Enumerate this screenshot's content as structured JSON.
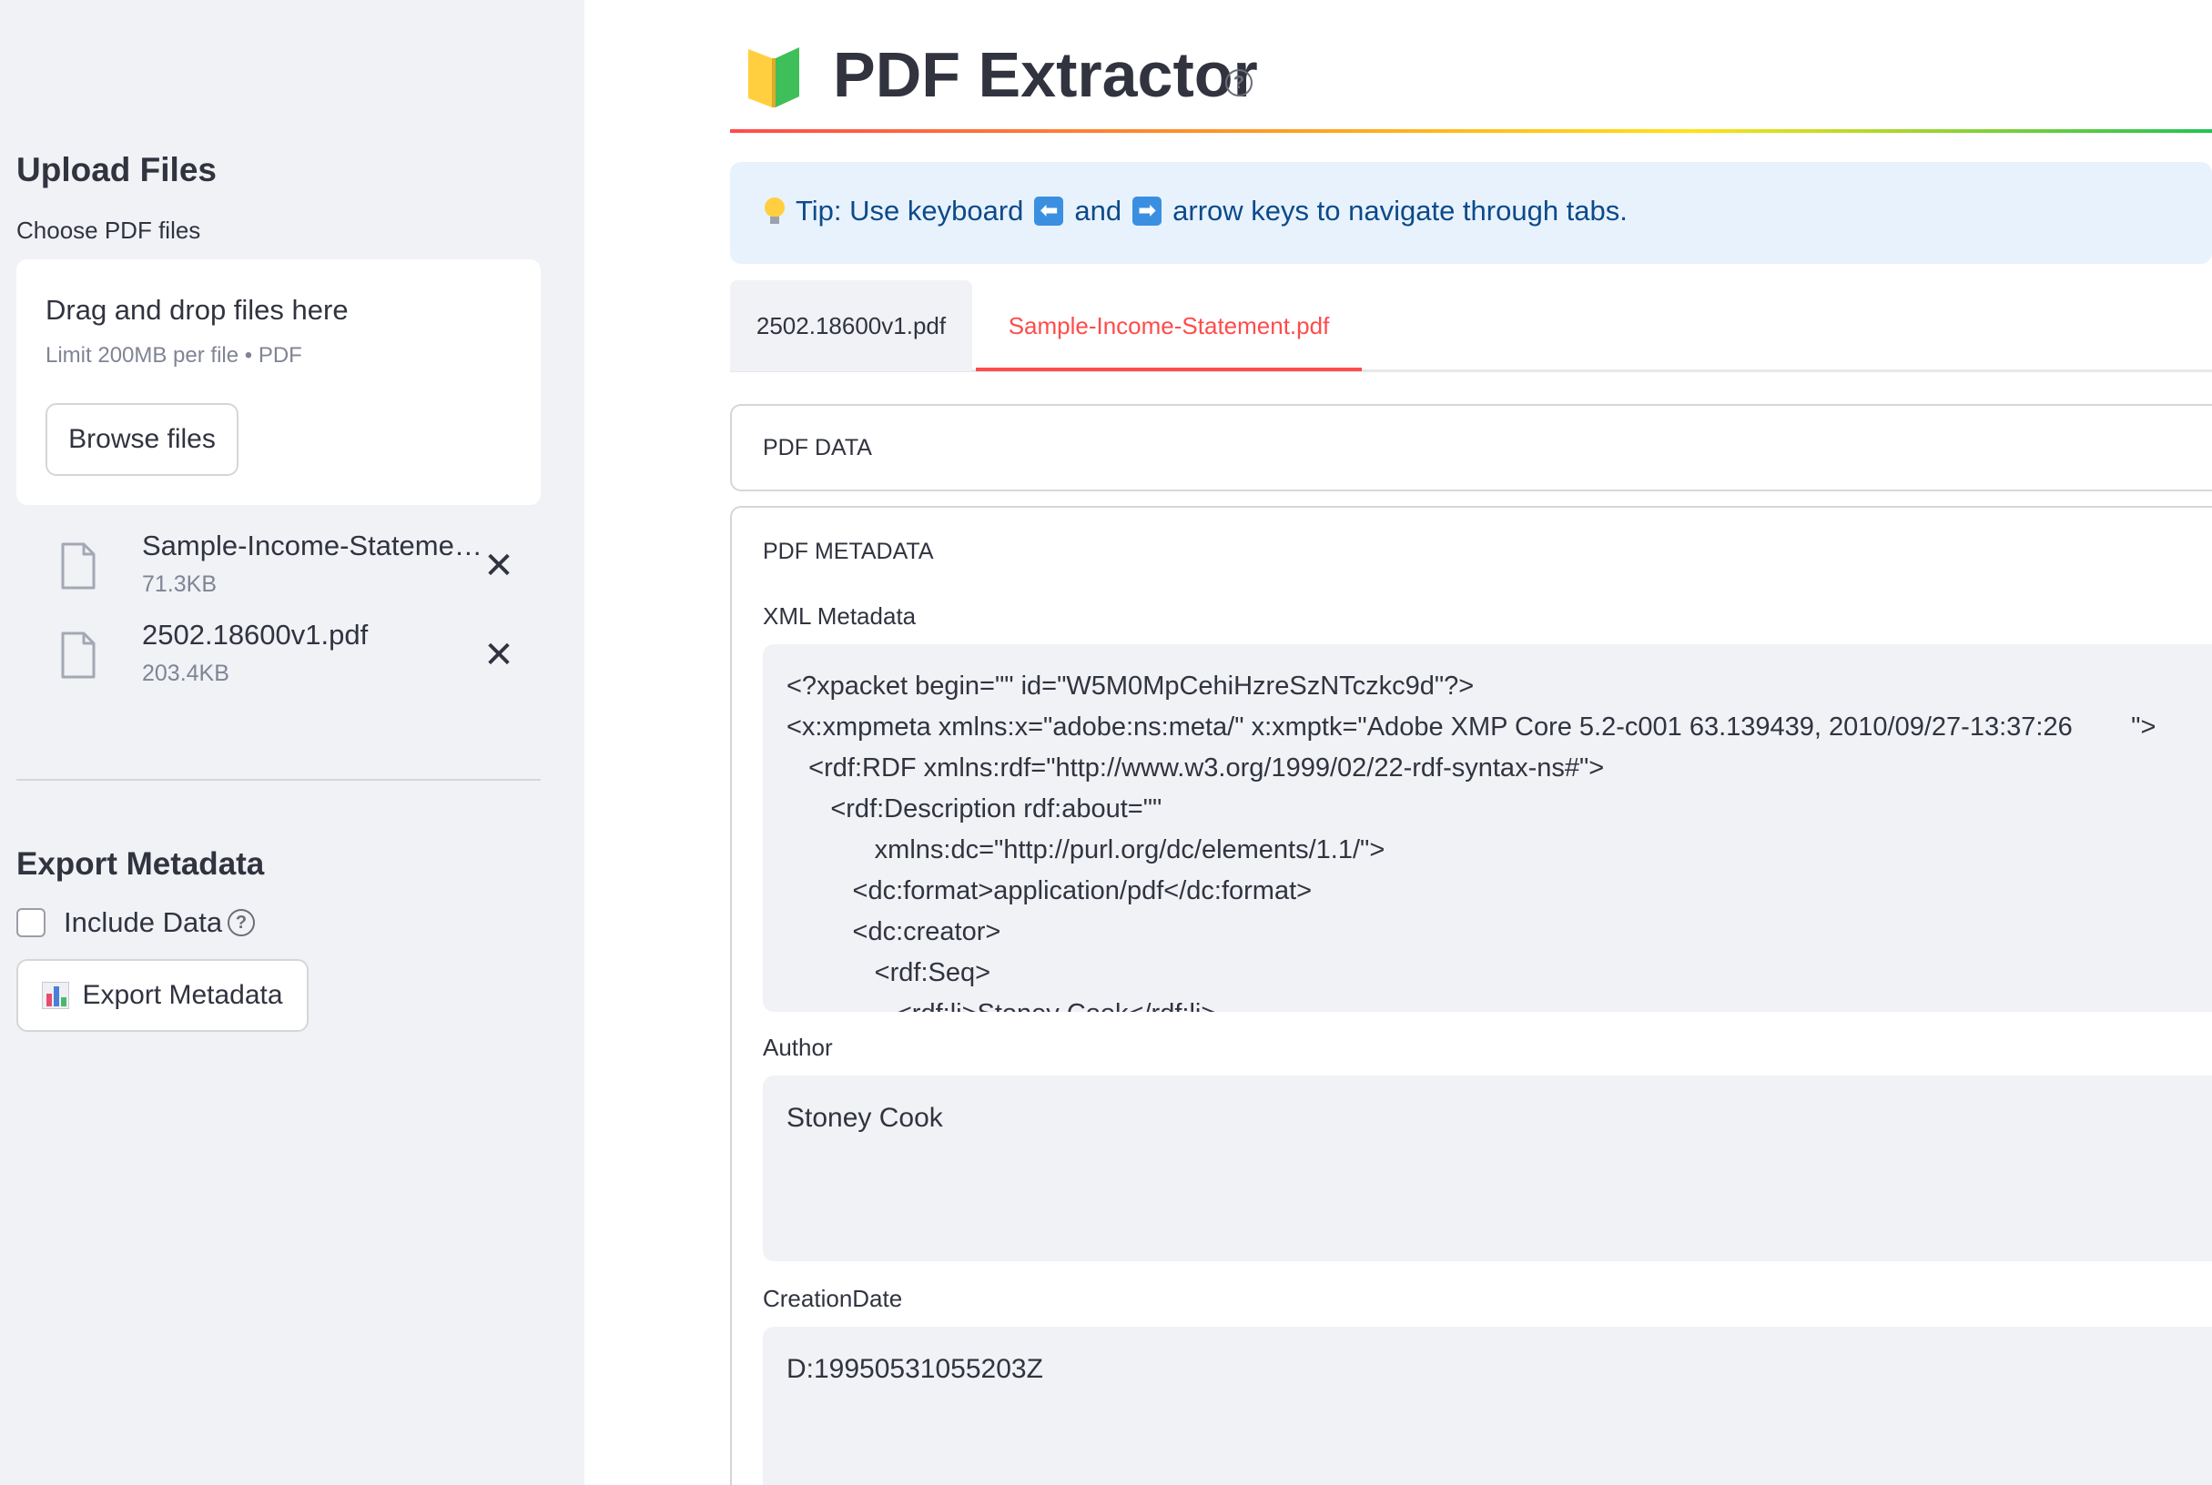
{
  "sidebar": {
    "upload_heading": "Upload Files",
    "choose_label": "Choose PDF files",
    "dropzone": {
      "title": "Drag and drop files here",
      "subtitle": "Limit 200MB per file • PDF",
      "browse_label": "Browse files"
    },
    "files": [
      {
        "name": "Sample-Income-Statement.pdf",
        "size": "71.3KB"
      },
      {
        "name": "2502.18600v1.pdf",
        "size": "203.4KB"
      }
    ],
    "export_heading": "Export Metadata",
    "include_data_label": "Include Data",
    "export_button_label": "Export Metadata"
  },
  "header": {
    "title": "PDF Extractor",
    "help_glyph": "?"
  },
  "tip": {
    "prefix": "Tip: Use keyboard",
    "left_key": "⬅",
    "middle": "and",
    "right_key": "➡",
    "suffix": "arrow keys to navigate through tabs."
  },
  "tabs": [
    {
      "label": "2502.18600v1.pdf",
      "active": false
    },
    {
      "label": "Sample-Income-Statement.pdf",
      "active": true
    }
  ],
  "pdf_data": {
    "title": "PDF DATA"
  },
  "pdf_metadata": {
    "title": "PDF METADATA",
    "xml_label": "XML Metadata",
    "xml_value": "<?xpacket begin=\"\" id=\"W5M0MpCehiHzreSzNTczkc9d\"?>\n<x:xmpmeta xmlns:x=\"adobe:ns:meta/\" x:xmptk=\"Adobe XMP Core 5.2-c001 63.139439, 2010/09/27-13:37:26        \">\n   <rdf:RDF xmlns:rdf=\"http://www.w3.org/1999/02/22-rdf-syntax-ns#\">\n      <rdf:Description rdf:about=\"\"\n            xmlns:dc=\"http://purl.org/dc/elements/1.1/\">\n         <dc:format>application/pdf</dc:format>\n         <dc:creator>\n            <rdf:Seq>\n               <rdf:li>Stoney Cook</rdf:li>",
    "author_label": "Author",
    "author_value": "Stoney Cook",
    "creation_label": "CreationDate",
    "creation_value": "D:19950531055203Z"
  },
  "colors": {
    "accent": "#ff4b4b",
    "tip_bg": "#e8f2fd",
    "tip_text": "#0c4a8a",
    "sidebar_bg": "#f0f2f6"
  }
}
